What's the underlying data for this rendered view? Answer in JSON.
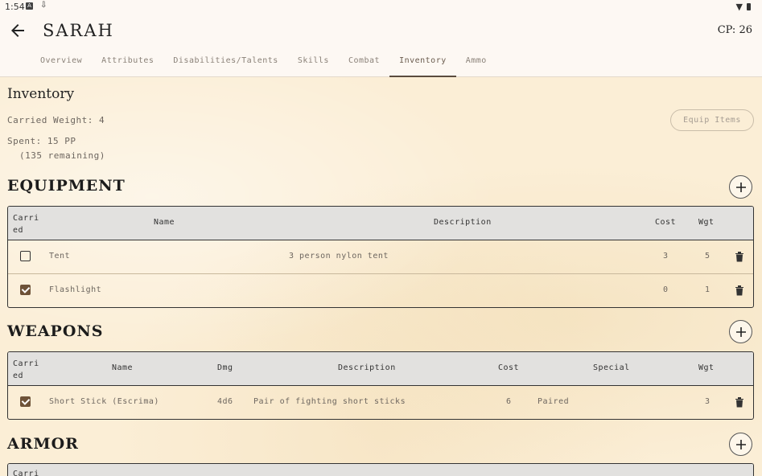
{
  "status": {
    "time": "1:54"
  },
  "header": {
    "title": "SARAH",
    "cp": "CP: 26"
  },
  "tabs": [
    "Overview",
    "Attributes",
    "Disabilities/Talents",
    "Skills",
    "Combat",
    "Inventory",
    "Ammo"
  ],
  "active_tab": "Inventory",
  "inventory": {
    "title": "Inventory",
    "carried_weight": "Carried Weight: 4",
    "spent": "Spent: 15 PP",
    "remaining": "(135 remaining)",
    "equip_button": "Equip Items"
  },
  "equipment": {
    "title": "EQUIPMENT",
    "headers": {
      "carried": "Carried",
      "name": "Name",
      "description": "Description",
      "cost": "Cost",
      "wgt": "Wgt"
    },
    "rows": [
      {
        "carried": false,
        "name": "Tent",
        "description": "3 person nylon tent",
        "cost": "3",
        "wgt": "5"
      },
      {
        "carried": true,
        "name": "Flashlight",
        "description": "",
        "cost": "0",
        "wgt": "1"
      }
    ]
  },
  "weapons": {
    "title": "WEAPONS",
    "headers": {
      "carried": "Carried",
      "name": "Name",
      "dmg": "Dmg",
      "description": "Description",
      "cost": "Cost",
      "special": "Special",
      "wgt": "Wgt"
    },
    "rows": [
      {
        "carried": true,
        "name": "Short Stick (Escrima)",
        "dmg": "4d6",
        "description": "Pair of fighting short sticks",
        "cost": "6",
        "special": "Paired",
        "wgt": "3"
      }
    ]
  },
  "armor": {
    "title": "ARMOR",
    "headers": {
      "carried": "Carri"
    }
  },
  "colors": {
    "accent": "#6e5238",
    "parchment": "#fbeed6",
    "header_bg": "#e2e1df"
  }
}
